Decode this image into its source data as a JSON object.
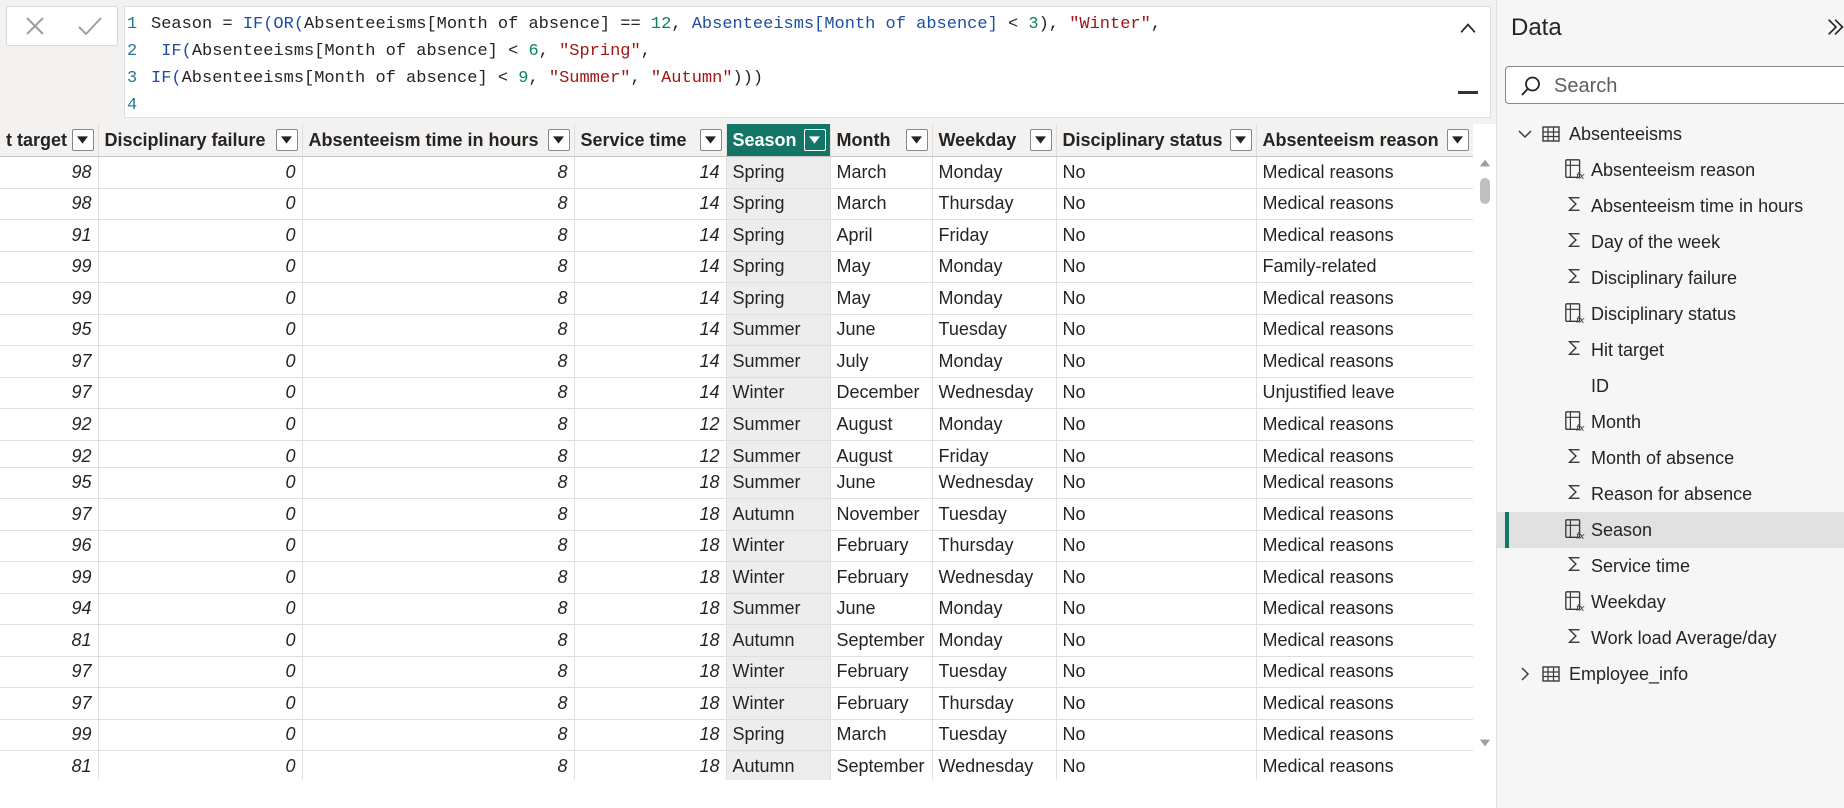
{
  "formula": {
    "cancel_icon": "close-icon",
    "commit_icon": "check-icon",
    "lines": [
      {
        "num": "1",
        "tokens": [
          {
            "t": "plain",
            "v": "Season = "
          },
          {
            "t": "fn",
            "v": "IF(OR("
          },
          {
            "t": "plain",
            "v": "Absenteeisms[Month of absence] == "
          },
          {
            "t": "num",
            "v": "12"
          },
          {
            "t": "plain",
            "v": ", "
          },
          {
            "t": "fn",
            "v": "Absenteeisms[Month of absence]"
          },
          {
            "t": "plain",
            "v": " < "
          },
          {
            "t": "num",
            "v": "3"
          },
          {
            "t": "plain",
            "v": "), "
          },
          {
            "t": "str",
            "v": "\"Winter\""
          },
          {
            "t": "plain",
            "v": ","
          }
        ]
      },
      {
        "num": "2",
        "tokens": [
          {
            "t": "plain",
            "v": " "
          },
          {
            "t": "fn",
            "v": "IF("
          },
          {
            "t": "plain",
            "v": "Absenteeisms[Month of absence] < "
          },
          {
            "t": "num",
            "v": "6"
          },
          {
            "t": "plain",
            "v": ", "
          },
          {
            "t": "str",
            "v": "\"Spring\""
          },
          {
            "t": "plain",
            "v": ","
          }
        ]
      },
      {
        "num": "3",
        "tokens": [
          {
            "t": "fn",
            "v": "IF("
          },
          {
            "t": "plain",
            "v": "Absenteeisms[Month of absence] < "
          },
          {
            "t": "num",
            "v": "9"
          },
          {
            "t": "plain",
            "v": ", "
          },
          {
            "t": "str",
            "v": "\"Summer\""
          },
          {
            "t": "plain",
            "v": ", "
          },
          {
            "t": "str",
            "v": "\"Autumn\""
          },
          {
            "t": "plain",
            "v": ")))"
          }
        ]
      },
      {
        "num": "4",
        "tokens": []
      }
    ]
  },
  "table": {
    "columns": [
      {
        "label": "t target",
        "width": 98,
        "type": "num"
      },
      {
        "label": "Disciplinary failure",
        "width": 204,
        "type": "num"
      },
      {
        "label": "Absenteeism time in hours",
        "width": 272,
        "type": "num"
      },
      {
        "label": "Service time",
        "width": 152,
        "type": "num"
      },
      {
        "label": "Season",
        "width": 104,
        "type": "text",
        "selected": true
      },
      {
        "label": "Month",
        "width": 102,
        "type": "text"
      },
      {
        "label": "Weekday",
        "width": 124,
        "type": "text"
      },
      {
        "label": "Disciplinary status",
        "width": 200,
        "type": "text"
      },
      {
        "label": "Absenteeism reason",
        "width": 217,
        "type": "text"
      }
    ],
    "rows": [
      [
        "98",
        "0",
        "8",
        "14",
        "Spring",
        "March",
        "Monday",
        "No",
        "Medical reasons"
      ],
      [
        "98",
        "0",
        "8",
        "14",
        "Spring",
        "March",
        "Thursday",
        "No",
        "Medical reasons"
      ],
      [
        "91",
        "0",
        "8",
        "14",
        "Spring",
        "April",
        "Friday",
        "No",
        "Medical reasons"
      ],
      [
        "99",
        "0",
        "8",
        "14",
        "Spring",
        "May",
        "Monday",
        "No",
        "Family-related"
      ],
      [
        "99",
        "0",
        "8",
        "14",
        "Spring",
        "May",
        "Monday",
        "No",
        "Medical reasons"
      ],
      [
        "95",
        "0",
        "8",
        "14",
        "Summer",
        "June",
        "Tuesday",
        "No",
        "Medical reasons"
      ],
      [
        "97",
        "0",
        "8",
        "14",
        "Summer",
        "July",
        "Monday",
        "No",
        "Medical reasons"
      ],
      [
        "97",
        "0",
        "8",
        "14",
        "Winter",
        "December",
        "Wednesday",
        "No",
        "Unjustified leave"
      ],
      [
        "92",
        "0",
        "8",
        "12",
        "Summer",
        "August",
        "Monday",
        "No",
        "Medical reasons"
      ],
      [
        "92",
        "0",
        "8",
        "12",
        "Summer",
        "August",
        "Friday",
        "No",
        "Medical reasons"
      ],
      [
        "95",
        "0",
        "8",
        "18",
        "Summer",
        "June",
        "Wednesday",
        "No",
        "Medical reasons"
      ],
      [
        "97",
        "0",
        "8",
        "18",
        "Autumn",
        "November",
        "Tuesday",
        "No",
        "Medical reasons"
      ],
      [
        "96",
        "0",
        "8",
        "18",
        "Winter",
        "February",
        "Thursday",
        "No",
        "Medical reasons"
      ],
      [
        "99",
        "0",
        "8",
        "18",
        "Winter",
        "February",
        "Wednesday",
        "No",
        "Medical reasons"
      ],
      [
        "94",
        "0",
        "8",
        "18",
        "Summer",
        "June",
        "Monday",
        "No",
        "Medical reasons"
      ],
      [
        "81",
        "0",
        "8",
        "18",
        "Autumn",
        "September",
        "Monday",
        "No",
        "Medical reasons"
      ],
      [
        "97",
        "0",
        "8",
        "18",
        "Winter",
        "February",
        "Tuesday",
        "No",
        "Medical reasons"
      ],
      [
        "97",
        "0",
        "8",
        "18",
        "Winter",
        "February",
        "Thursday",
        "No",
        "Medical reasons"
      ],
      [
        "99",
        "0",
        "8",
        "18",
        "Spring",
        "March",
        "Tuesday",
        "No",
        "Medical reasons"
      ],
      [
        "81",
        "0",
        "8",
        "18",
        "Autumn",
        "September",
        "Wednesday",
        "No",
        "Medical reasons"
      ]
    ]
  },
  "data_pane": {
    "title": "Data",
    "collapse_icon": "double-chevron-right-icon",
    "search": {
      "placeholder": "Search",
      "value": "",
      "icon": "search-icon"
    },
    "tables": [
      {
        "name": "Absenteeisms",
        "expanded": true,
        "fields": [
          {
            "name": "Absenteeism reason",
            "icon": "calculated-column-icon"
          },
          {
            "name": "Absenteeism time in hours",
            "icon": "sum-icon"
          },
          {
            "name": "Day of the week",
            "icon": "sum-icon"
          },
          {
            "name": "Disciplinary failure",
            "icon": "sum-icon"
          },
          {
            "name": "Disciplinary status",
            "icon": "calculated-column-icon"
          },
          {
            "name": "Hit target",
            "icon": "sum-icon"
          },
          {
            "name": "ID",
            "icon": "none"
          },
          {
            "name": "Month",
            "icon": "calculated-column-icon"
          },
          {
            "name": "Month of absence",
            "icon": "sum-icon"
          },
          {
            "name": "Reason for absence",
            "icon": "sum-icon"
          },
          {
            "name": "Season",
            "icon": "calculated-column-icon",
            "active": true
          },
          {
            "name": "Service time",
            "icon": "sum-icon"
          },
          {
            "name": "Weekday",
            "icon": "calculated-column-icon"
          },
          {
            "name": "Work load Average/day",
            "icon": "sum-icon"
          }
        ]
      },
      {
        "name": "Employee_info",
        "expanded": false,
        "fields": []
      }
    ]
  },
  "colors": {
    "accent": "#127566",
    "header_bg": "#f3f2f1",
    "selected_col_bg": "#ededed"
  }
}
